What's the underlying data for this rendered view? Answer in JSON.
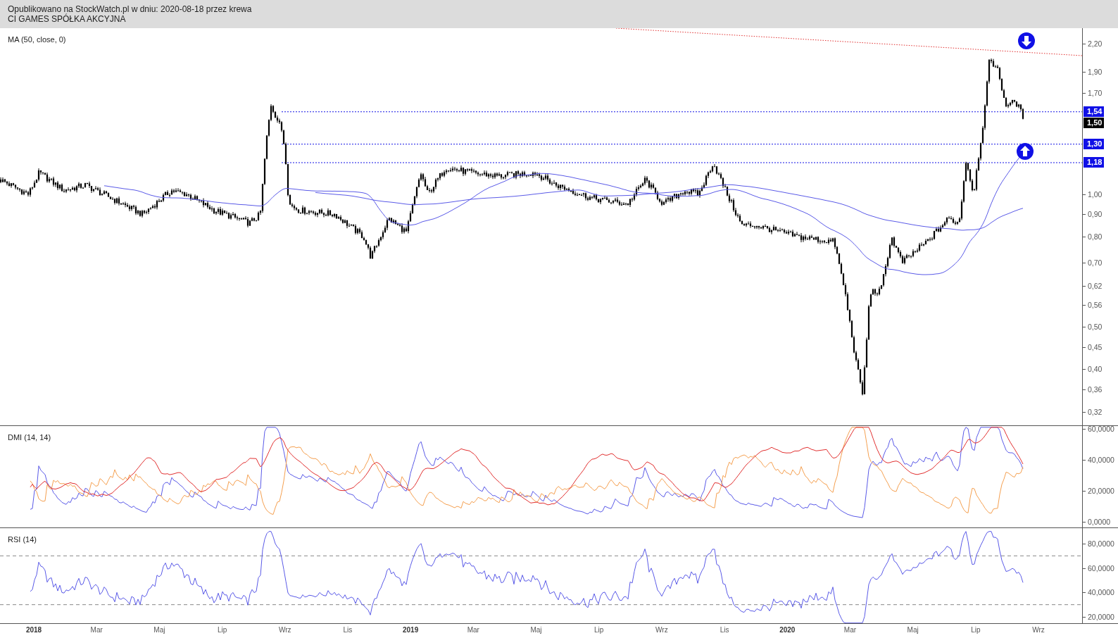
{
  "header": {
    "published": "Opublikowano na StockWatch.pl w dniu: 2020-08-18 przez krewa",
    "instrument": "CI GAMES SPÓŁKA AKCYJNA"
  },
  "panels": [
    {
      "kind": "price",
      "title": "MA (50, close, 0)",
      "y_labels": [
        "2,20",
        "1,90",
        "1,70",
        "1,00",
        "0,90",
        "0,80",
        "0,70",
        "0,62",
        "0,56",
        "0,50",
        "0,45",
        "0,40",
        "0,36",
        "0,32"
      ],
      "price_tags": [
        {
          "text": "1,54",
          "kind": "level",
          "color": "#1010e6"
        },
        {
          "text": "1,50",
          "kind": "last",
          "color": "#000000"
        },
        {
          "text": "1,30",
          "kind": "level",
          "color": "#1010e6"
        },
        {
          "text": "1,18",
          "kind": "level",
          "color": "#1010e6"
        }
      ]
    },
    {
      "kind": "dmi",
      "title": "DMI (14, 14)",
      "y_labels": [
        "60,0000",
        "40,0000",
        "20,0000",
        "0,0000"
      ]
    },
    {
      "kind": "rsi",
      "title": "RSI (14)",
      "y_labels": [
        "80,0000",
        "60,0000",
        "40,0000",
        "20,0000"
      ]
    }
  ],
  "x_axis": [
    {
      "label": "2018",
      "kind": "year"
    },
    {
      "label": "Mar",
      "kind": "month"
    },
    {
      "label": "Maj",
      "kind": "month"
    },
    {
      "label": "Lip",
      "kind": "month"
    },
    {
      "label": "Wrz",
      "kind": "month"
    },
    {
      "label": "Lis",
      "kind": "month"
    },
    {
      "label": "2019",
      "kind": "year"
    },
    {
      "label": "Mar",
      "kind": "month"
    },
    {
      "label": "Maj",
      "kind": "month"
    },
    {
      "label": "Lip",
      "kind": "month"
    },
    {
      "label": "Wrz",
      "kind": "month"
    },
    {
      "label": "Lis",
      "kind": "month"
    },
    {
      "label": "2020",
      "kind": "year"
    },
    {
      "label": "Mar",
      "kind": "month"
    },
    {
      "label": "Maj",
      "kind": "month"
    },
    {
      "label": "Lip",
      "kind": "month"
    },
    {
      "label": "Wrz",
      "kind": "month"
    }
  ]
}
